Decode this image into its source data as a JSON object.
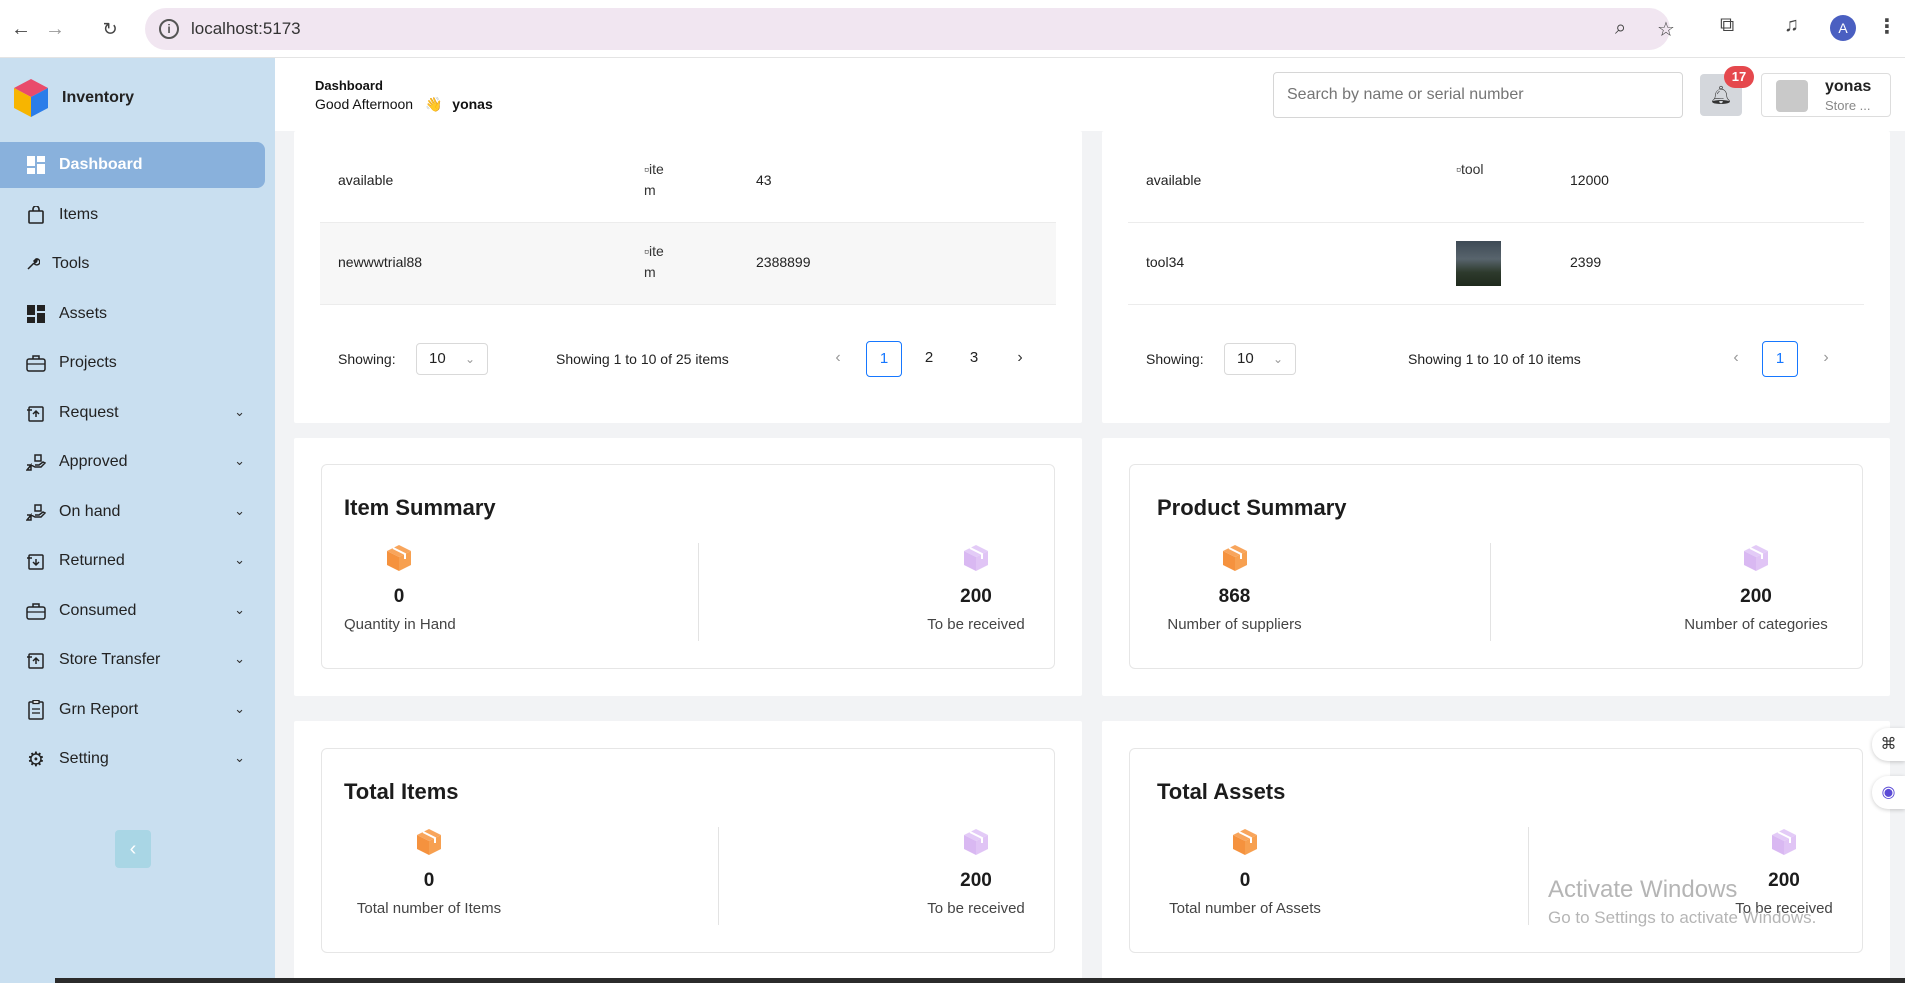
{
  "browser": {
    "url": "localhost:5173",
    "profile_initial": "A",
    "icons": [
      "back-icon",
      "forward-icon",
      "reload-icon",
      "info-icon",
      "zoom-icon",
      "star-icon",
      "extensions-icon",
      "media-icon",
      "menu-icon"
    ]
  },
  "sidebar": {
    "brand": "Inventory",
    "items": [
      {
        "label": "Dashboard",
        "icon": "dashboard-icon",
        "active": true,
        "has_children": false
      },
      {
        "label": "Items",
        "icon": "bag-icon",
        "has_children": false
      },
      {
        "label": "Tools",
        "icon": "wrench-icon",
        "has_children": false
      },
      {
        "label": "Assets",
        "icon": "grid-icon",
        "has_children": false
      },
      {
        "label": "Projects",
        "icon": "briefcase-icon",
        "has_children": false
      },
      {
        "label": "Request",
        "icon": "request-icon",
        "has_children": true
      },
      {
        "label": "Approved",
        "icon": "hand-icon",
        "has_children": true
      },
      {
        "label": "On hand",
        "icon": "hand-icon",
        "has_children": true
      },
      {
        "label": "Returned",
        "icon": "return-icon",
        "has_children": true
      },
      {
        "label": "Consumed",
        "icon": "briefcase-icon",
        "has_children": true
      },
      {
        "label": "Store Transfer",
        "icon": "transfer-icon",
        "has_children": true
      },
      {
        "label": "Grn Report",
        "icon": "report-icon",
        "has_children": true
      },
      {
        "label": "Setting",
        "icon": "gear-icon",
        "has_children": true
      }
    ]
  },
  "header": {
    "title": "Dashboard",
    "greeting": "Good Afternoon",
    "wave": "👋",
    "user": "yonas",
    "search_placeholder": "Search by name or serial number",
    "notifications": "17",
    "user_name": "yonas",
    "user_role": "Store ..."
  },
  "items_table": {
    "rows": [
      {
        "name": "available",
        "image_alt": "item",
        "qty": "43"
      },
      {
        "name": "newwwtrial88",
        "image_alt": "item",
        "qty": "2388899"
      }
    ],
    "showing_label": "Showing:",
    "page_size": "10",
    "summary": "Showing 1 to 10 of 25 items",
    "pages": [
      "1",
      "2",
      "3"
    ],
    "current_page": "1"
  },
  "tools_table": {
    "rows": [
      {
        "name": "available",
        "image_alt": "tool",
        "qty": "12000"
      },
      {
        "name": "tool34",
        "image_alt": "",
        "qty": "2399"
      }
    ],
    "showing_label": "Showing:",
    "page_size": "10",
    "summary": "Showing 1 to 10 of 10 items",
    "pages": [
      "1"
    ],
    "current_page": "1"
  },
  "item_summary": {
    "title": "Item Summary",
    "left": {
      "value": "0",
      "label": "Quantity in Hand"
    },
    "right": {
      "value": "200",
      "label": "To be received"
    }
  },
  "product_summary": {
    "title": "Product Summary",
    "left": {
      "value": "868",
      "label": "Number of suppliers"
    },
    "right": {
      "value": "200",
      "label": "Number of categories"
    }
  },
  "total_items": {
    "title": "Total Items",
    "left": {
      "value": "0",
      "label": "Total number of Items"
    },
    "right": {
      "value": "200",
      "label": "To be received"
    }
  },
  "total_assets": {
    "title": "Total Assets",
    "left": {
      "value": "0",
      "label": "Total number of Assets"
    },
    "right": {
      "value": "200",
      "label": "To be received"
    }
  },
  "watermark": {
    "line1": "Activate Windows",
    "line2": "Go to Settings to activate Windows."
  },
  "colors": {
    "sidebar_bg": "#c9dff0",
    "active_item": "#89b1dc",
    "box_orange": "#f5923e",
    "box_purple": "#d9b8f2",
    "pager_blue": "#1677ff",
    "badge_red": "#e5484d"
  }
}
